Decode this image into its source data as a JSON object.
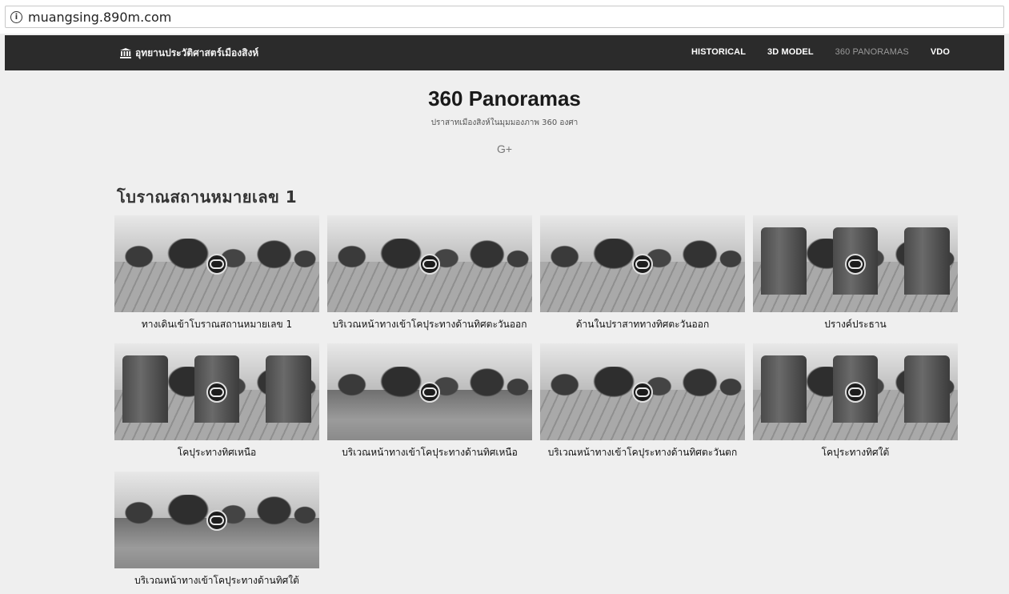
{
  "browser": {
    "url": "muangsing.890m.com"
  },
  "navbar": {
    "brand": "อุทยานประวัติศาสตร์เมืองสิงห์",
    "items": [
      {
        "label": "HISTORICAL",
        "active": false
      },
      {
        "label": "3D MODEL",
        "active": false
      },
      {
        "label": "360 PANORAMAS",
        "active": true
      },
      {
        "label": "VDO",
        "active": false
      }
    ]
  },
  "header": {
    "title": "360 Panoramas",
    "subtitle": "ปราสาทเมืองสิงห์ในมุมมองภาพ 360 องศา",
    "share": "G+"
  },
  "section": {
    "title": "โบราณสถานหมายเลข 1"
  },
  "panoramas": [
    {
      "caption": "ทางเดินเข้าโบราณสถานหมายเลข 1",
      "scene": "stone",
      "icon": "360-view-icon"
    },
    {
      "caption": "บริเวณหน้าทางเข้าโคปุระทางด้านทิศตะวันออก",
      "scene": "stone",
      "icon": "360-view-icon"
    },
    {
      "caption": "ด้านในปราสาททางทิศตะวันออก",
      "scene": "stone",
      "icon": "360-view-icon"
    },
    {
      "caption": "ปรางค์ประธาน",
      "scene": "ruins",
      "icon": "360-view-icon"
    },
    {
      "caption": "โคปุระทางทิศเหนือ",
      "scene": "ruins",
      "icon": "360-view-icon"
    },
    {
      "caption": "บริเวณหน้าทางเข้าโคปุระทางด้านทิศเหนือ",
      "scene": "grass",
      "icon": "360-view-icon"
    },
    {
      "caption": "บริเวณหน้าทางเข้าโคปุระทางด้านทิศตะวันตก",
      "scene": "stone",
      "icon": "360-view-icon"
    },
    {
      "caption": "โคปุระทางทิศใต้",
      "scene": "ruins",
      "icon": "360-view-icon"
    },
    {
      "caption": "บริเวณหน้าทางเข้าโคปุระทางด้านทิศใต้",
      "scene": "grass",
      "icon": "360-view-icon"
    }
  ]
}
